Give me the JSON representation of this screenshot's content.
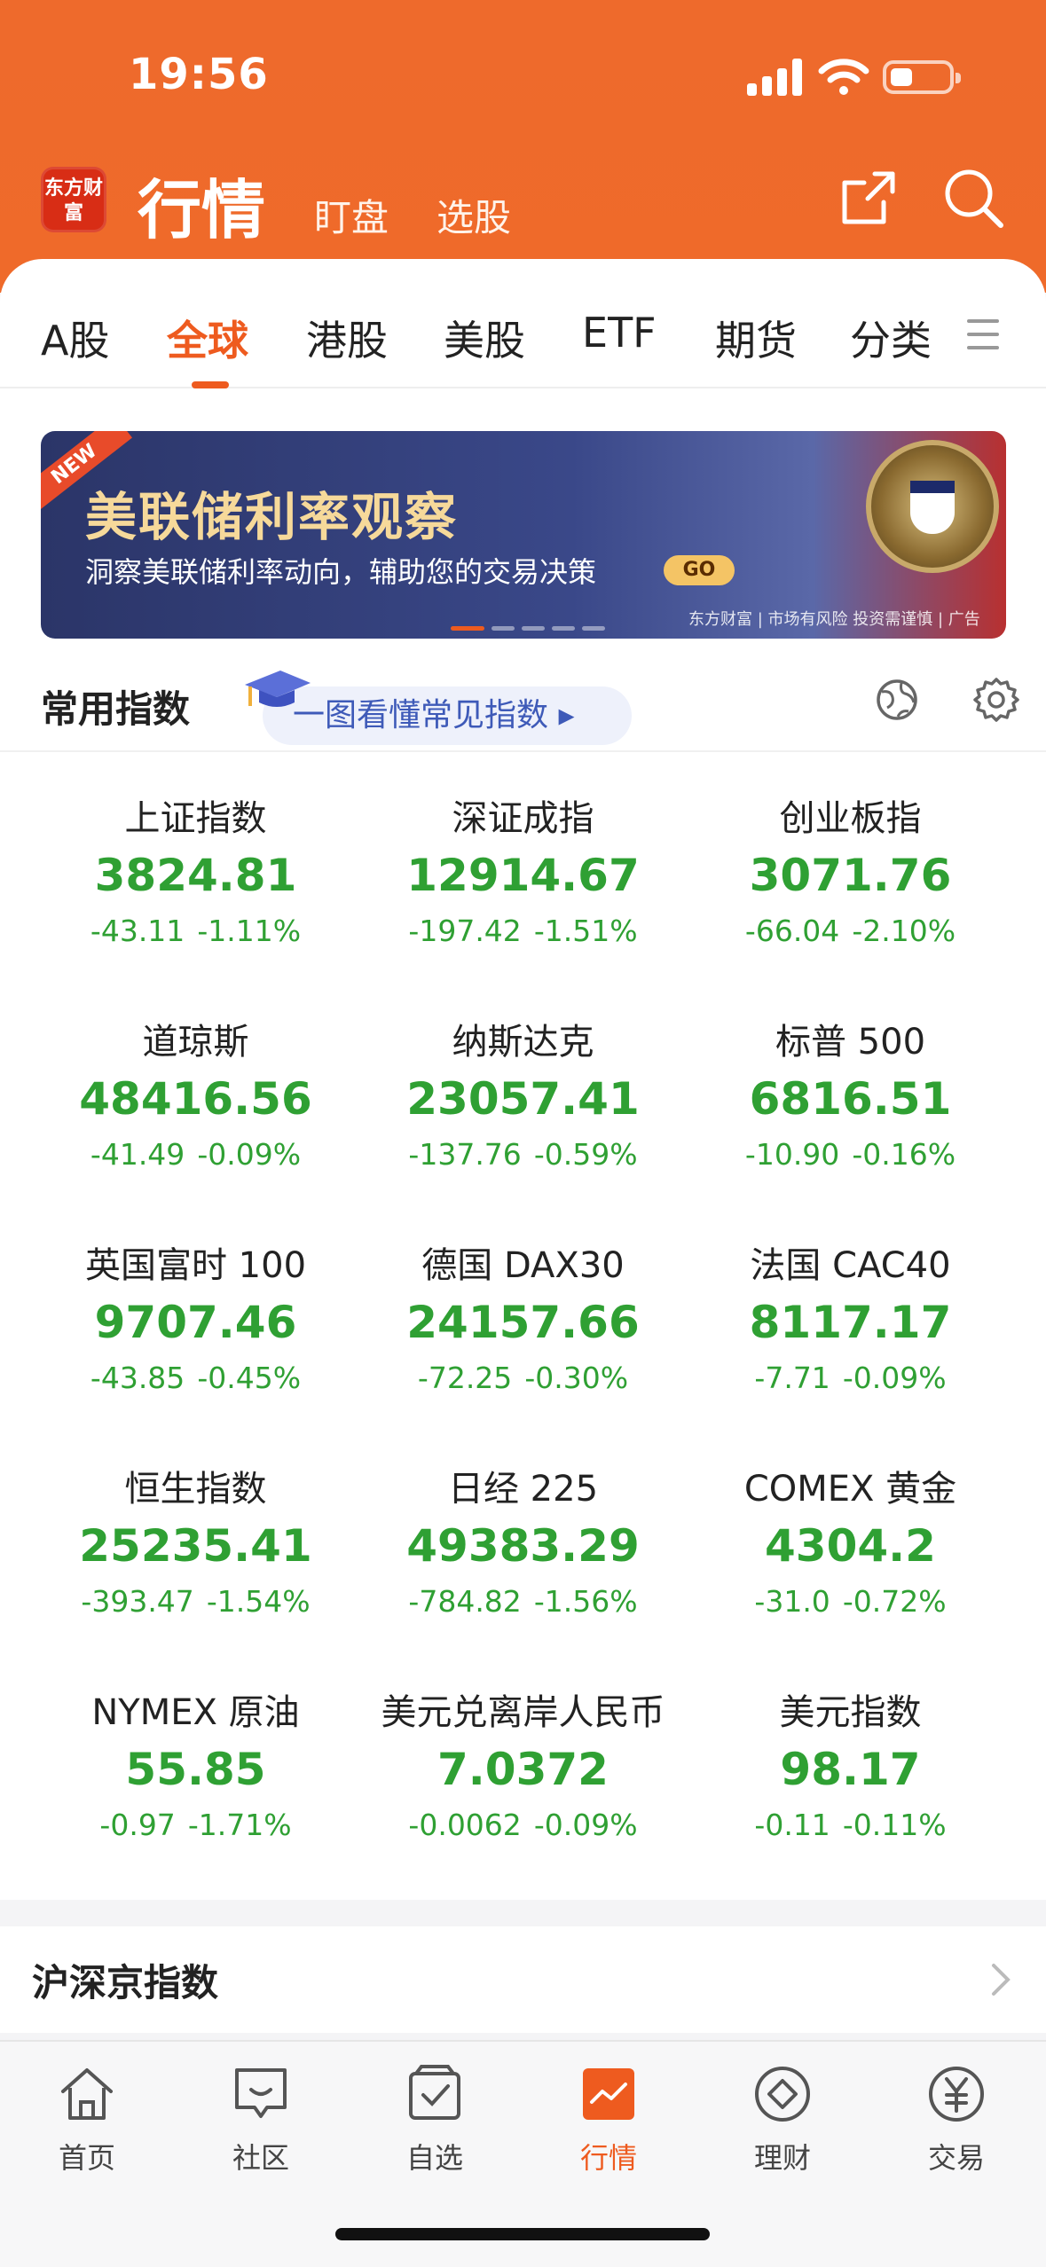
{
  "status_bar": {
    "time": "19:56"
  },
  "header": {
    "logo_text": "东方财富",
    "title": "行情",
    "sub_tabs": [
      "盯盘",
      "选股"
    ]
  },
  "tabs": [
    "A股",
    "全球",
    "港股",
    "美股",
    "ETF",
    "期货",
    "分类"
  ],
  "active_tab": "全球",
  "banner": {
    "badge": "NEW",
    "title": "美联储利率观察",
    "subtitle": "洞察美联储利率动向，辅助您的交易决策",
    "go_label": "GO",
    "note": "东方财富 | 市场有风险 投资需谨慎 | 广告"
  },
  "common": {
    "title": "常用指数",
    "guide_label": "一图看懂常见指数 ▸"
  },
  "indices": [
    {
      "name": "上证指数",
      "price": "3824.81",
      "change": "-43.11",
      "pct": "-1.11%"
    },
    {
      "name": "深证成指",
      "price": "12914.67",
      "change": "-197.42",
      "pct": "-1.51%"
    },
    {
      "name": "创业板指",
      "price": "3071.76",
      "change": "-66.04",
      "pct": "-2.10%"
    },
    {
      "name": "道琼斯",
      "price": "48416.56",
      "change": "-41.49",
      "pct": "-0.09%"
    },
    {
      "name": "纳斯达克",
      "price": "23057.41",
      "change": "-137.76",
      "pct": "-0.59%"
    },
    {
      "name": "标普 500",
      "price": "6816.51",
      "change": "-10.90",
      "pct": "-0.16%"
    },
    {
      "name": "英国富时 100",
      "price": "9707.46",
      "change": "-43.85",
      "pct": "-0.45%"
    },
    {
      "name": "德国 DAX30",
      "price": "24157.66",
      "change": "-72.25",
      "pct": "-0.30%"
    },
    {
      "name": "法国 CAC40",
      "price": "8117.17",
      "change": "-7.71",
      "pct": "-0.09%"
    },
    {
      "name": "恒生指数",
      "price": "25235.41",
      "change": "-393.47",
      "pct": "-1.54%"
    },
    {
      "name": "日经 225",
      "price": "49383.29",
      "change": "-784.82",
      "pct": "-1.56%"
    },
    {
      "name": "COMEX 黄金",
      "price": "4304.2",
      "change": "-31.0",
      "pct": "-0.72%"
    },
    {
      "name": "NYMEX 原油",
      "price": "55.85",
      "change": "-0.97",
      "pct": "-1.71%"
    },
    {
      "name": "美元兑离岸人民币",
      "price": "7.0372",
      "change": "-0.0062",
      "pct": "-0.09%"
    },
    {
      "name": "美元指数",
      "price": "98.17",
      "change": "-0.11",
      "pct": "-0.11%"
    }
  ],
  "section2": {
    "title": "沪深京指数"
  },
  "bottom_nav": [
    {
      "label": "首页",
      "icon": "home-icon"
    },
    {
      "label": "社区",
      "icon": "community-icon"
    },
    {
      "label": "自选",
      "icon": "watchlist-icon"
    },
    {
      "label": "行情",
      "icon": "market-icon"
    },
    {
      "label": "理财",
      "icon": "wealth-icon"
    },
    {
      "label": "交易",
      "icon": "trade-icon"
    }
  ],
  "colors": {
    "accent": "#ee5b1f",
    "down": "#2fa033",
    "header": "#ef6a2a"
  }
}
